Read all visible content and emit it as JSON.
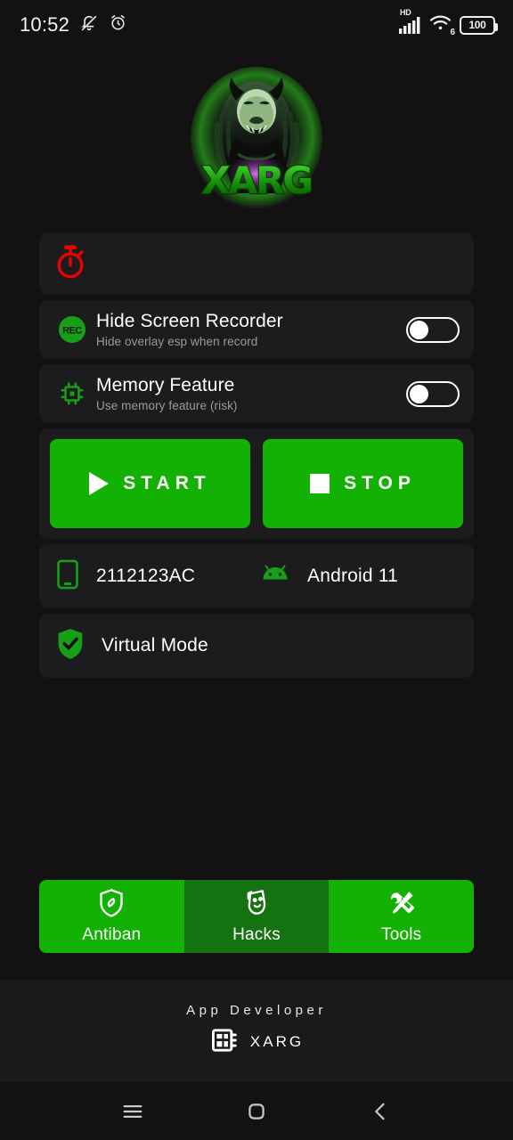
{
  "statusbar": {
    "time": "10:52",
    "mute_icon": "bell-off-icon",
    "alarm_icon": "alarm-clock-icon",
    "network_label": "HD",
    "signal_icon": "signal-bars-icon",
    "wifi_icon": "wifi-icon",
    "wifi_generation": "6",
    "battery_level": "100"
  },
  "brand": {
    "logo_name": "xarg-monster-logo",
    "logo_text": "XARG",
    "accent_green": "#12b104",
    "glow_green": "#35e02a"
  },
  "timer_card": {
    "icon": "stopwatch-icon",
    "icon_color": "#ee0000"
  },
  "toggles": [
    {
      "icon": "rec-circle-icon",
      "title": "Hide Screen Recorder",
      "subtitle": "Hide overlay esp when record",
      "state": "off"
    },
    {
      "icon": "memory-chip-icon",
      "title": "Memory Feature",
      "subtitle": "Use memory feature (risk)",
      "state": "off"
    }
  ],
  "actions": {
    "start_label": "START",
    "start_icon": "play-icon",
    "stop_label": "STOP",
    "stop_icon": "stop-square-icon"
  },
  "device": {
    "phone_icon": "smartphone-icon",
    "model": "2112123AC",
    "android_icon": "android-robot-icon",
    "os_version": "Android 11"
  },
  "virtual_mode": {
    "icon": "shield-check-icon",
    "label": "Virtual Mode"
  },
  "tabs": [
    {
      "icon": "shield-link-icon",
      "label": "Antiban",
      "active": false
    },
    {
      "icon": "theater-mask-icon",
      "label": "Hacks",
      "active": true
    },
    {
      "icon": "tools-icon",
      "label": "Tools",
      "active": false
    }
  ],
  "footer": {
    "title": "App Developer",
    "icon": "chip-icon",
    "name": "XARG"
  },
  "navbar": {
    "recents_icon": "menu-icon",
    "home_icon": "home-square-icon",
    "back_icon": "chevron-left-icon"
  }
}
